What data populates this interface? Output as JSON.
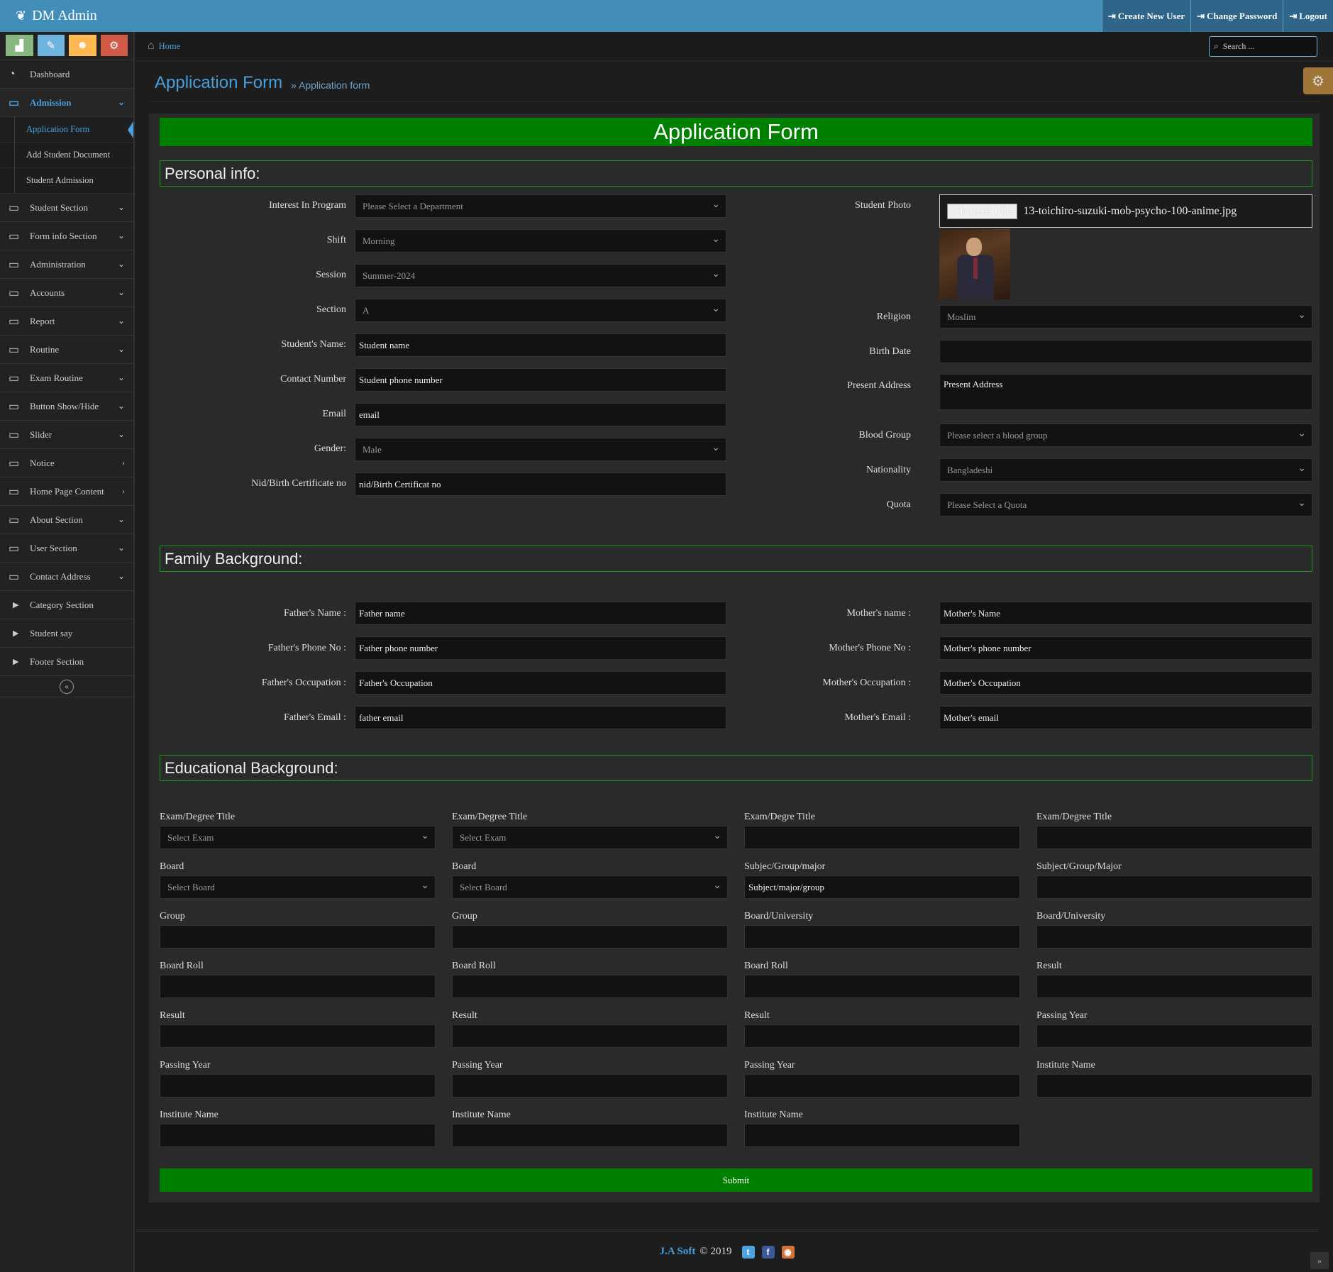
{
  "app": {
    "brand": "DM Admin"
  },
  "topnav": {
    "create_user": "Create New User",
    "change_password": "Change Password",
    "logout": "Logout"
  },
  "colors": {
    "navbar": "#438eb9",
    "accent": "#4a9fdb",
    "banner": "#008000"
  },
  "sidebar": {
    "items": [
      {
        "label": "Dashboard"
      },
      {
        "label": "Admission"
      },
      {
        "label": "Student Section"
      },
      {
        "label": "Form info Section"
      },
      {
        "label": "Administration"
      },
      {
        "label": "Accounts"
      },
      {
        "label": "Report"
      },
      {
        "label": "Routine"
      },
      {
        "label": "Exam Routine"
      },
      {
        "label": "Button Show/Hide"
      },
      {
        "label": "Slider"
      },
      {
        "label": "Notice"
      },
      {
        "label": "Home Page Content"
      },
      {
        "label": "About Section"
      },
      {
        "label": "User Section"
      },
      {
        "label": "Contact Address"
      },
      {
        "label": "Category Section"
      },
      {
        "label": "Student say"
      },
      {
        "label": "Footer Section"
      }
    ],
    "sub_items": [
      {
        "label": "Application Form"
      },
      {
        "label": "Add Student Document"
      },
      {
        "label": "Student Admission"
      }
    ]
  },
  "breadcrumb": {
    "home": "Home"
  },
  "search": {
    "placeholder": "Search ..."
  },
  "page": {
    "title": "Application Form",
    "subtitle": "» Application form"
  },
  "form": {
    "banner": "Application Form",
    "sections": {
      "personal": "Personal info:",
      "family": "Family Background:",
      "education": "Educational Background:"
    },
    "personal_left": [
      {
        "label": "Interest In Program",
        "value": "Please Select a Department"
      },
      {
        "label": "Shift",
        "value": "Morning"
      },
      {
        "label": "Session",
        "value": "Summer-2024"
      },
      {
        "label": "Section",
        "value": "A"
      },
      {
        "label": "Student's Name:",
        "value": "Student name"
      },
      {
        "label": "Contact Number",
        "value": "Student phone number"
      },
      {
        "label": "Email",
        "value": "email"
      },
      {
        "label": "Gender:",
        "value": "Male"
      },
      {
        "label": "Nid/Birth Certificate no",
        "value": "nid/Birth Certificat no"
      }
    ],
    "photo": {
      "label": "Student Photo",
      "button": "Choose File",
      "filename": "13-toichiro-suzuki-mob-psycho-100-anime.jpg"
    },
    "personal_right": [
      {
        "label": "Religion",
        "value": "Moslim"
      },
      {
        "label": "Birth Date",
        "value": ""
      },
      {
        "label": "Present Address",
        "value": "Present Address"
      },
      {
        "label": "Blood Group",
        "value": "Please select a blood group"
      },
      {
        "label": "Nationality",
        "value": "Bangladeshi"
      },
      {
        "label": "Quota",
        "value": "Please Select a Quota"
      }
    ],
    "family_left": [
      {
        "label": "Father's Name :",
        "value": "Father name"
      },
      {
        "label": "Father's Phone No :",
        "value": "Father phone number"
      },
      {
        "label": "Father's Occupation :",
        "value": "Father's Occupation"
      },
      {
        "label": "Father's Email :",
        "value": "father email"
      }
    ],
    "family_right": [
      {
        "label": "Mother's name :",
        "value": "Mother's Name"
      },
      {
        "label": "Mother's Phone No :",
        "value": "Mother's phone number"
      },
      {
        "label": "Mother's Occupation :",
        "value": "Mother's Occupation"
      },
      {
        "label": "Mother's Email :",
        "value": "Mother's email"
      }
    ],
    "education": [
      [
        {
          "label": "Exam/Degree Title",
          "value": "Select Exam"
        },
        {
          "label": "Board",
          "value": "Select Board"
        },
        {
          "label": "Group",
          "value": ""
        },
        {
          "label": "Board Roll",
          "value": ""
        },
        {
          "label": "Result",
          "value": ""
        },
        {
          "label": "Passing Year",
          "value": ""
        },
        {
          "label": "Institute Name",
          "value": ""
        }
      ],
      [
        {
          "label": "Exam/Degree Title",
          "value": "Select Exam"
        },
        {
          "label": "Board",
          "value": "Select Board"
        },
        {
          "label": "Group",
          "value": ""
        },
        {
          "label": "Board Roll",
          "value": ""
        },
        {
          "label": "Result",
          "value": ""
        },
        {
          "label": "Passing Year",
          "value": ""
        },
        {
          "label": "Institute Name",
          "value": ""
        }
      ],
      [
        {
          "label": "Exam/Degre Title",
          "value": ""
        },
        {
          "label": "Subjec/Group/major",
          "value": "Subject/major/group"
        },
        {
          "label": "Board/University",
          "value": ""
        },
        {
          "label": "Board Roll",
          "value": ""
        },
        {
          "label": "Result",
          "value": ""
        },
        {
          "label": "Passing Year",
          "value": ""
        },
        {
          "label": "Institute Name",
          "value": ""
        }
      ],
      [
        {
          "label": "Exam/Degree Title",
          "value": ""
        },
        {
          "label": "Subject/Group/Major",
          "value": ""
        },
        {
          "label": "Board/University",
          "value": ""
        },
        {
          "label": "Result",
          "value": ""
        },
        {
          "label": "Passing Year",
          "value": ""
        },
        {
          "label": "Institute Name",
          "value": ""
        }
      ]
    ],
    "submit": "Submit"
  },
  "footer": {
    "brand": "J.A Soft",
    "copyright": "© 2019"
  }
}
